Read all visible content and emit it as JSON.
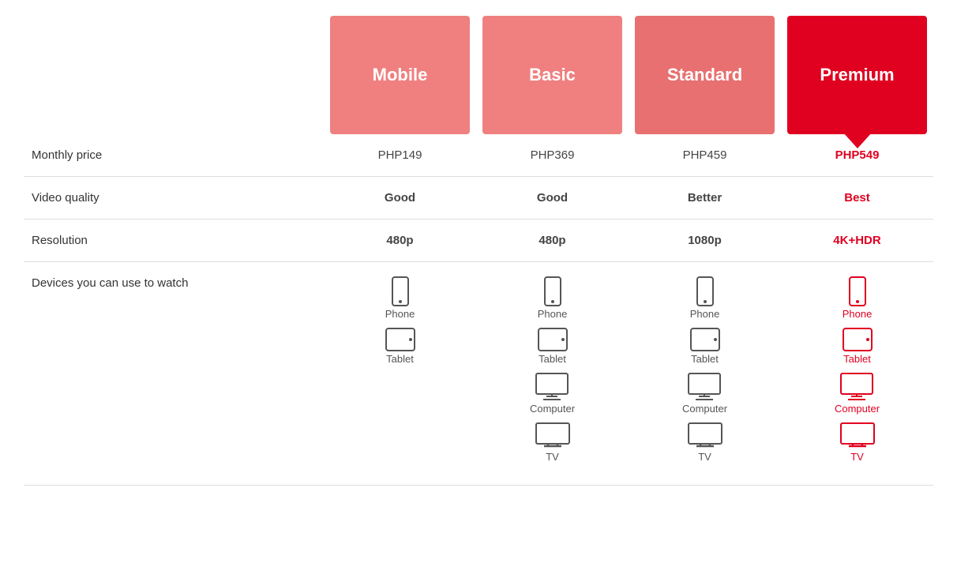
{
  "plans": [
    {
      "id": "mobile",
      "label": "Mobile",
      "class": "mobile",
      "price": "PHP149",
      "videoQuality": "Good",
      "resolution": "480p",
      "highlight": false
    },
    {
      "id": "basic",
      "label": "Basic",
      "class": "basic",
      "price": "PHP369",
      "videoQuality": "Good",
      "resolution": "480p",
      "highlight": false
    },
    {
      "id": "standard",
      "label": "Standard",
      "class": "standard",
      "price": "PHP459",
      "videoQuality": "Better",
      "resolution": "1080p",
      "highlight": false
    },
    {
      "id": "premium",
      "label": "Premium",
      "class": "premium",
      "price": "PHP549",
      "videoQuality": "Best",
      "resolution": "4K+HDR",
      "highlight": true
    }
  ],
  "rows": {
    "monthly_price": "Monthly price",
    "video_quality": "Video quality",
    "resolution": "Resolution",
    "devices": "Devices you can use to watch"
  },
  "devices": {
    "mobile": [
      "phone",
      "tablet"
    ],
    "basic": [
      "phone",
      "tablet",
      "computer",
      "tv"
    ],
    "standard": [
      "phone",
      "tablet",
      "computer",
      "tv"
    ],
    "premium": [
      "phone",
      "tablet",
      "computer",
      "tv"
    ]
  }
}
